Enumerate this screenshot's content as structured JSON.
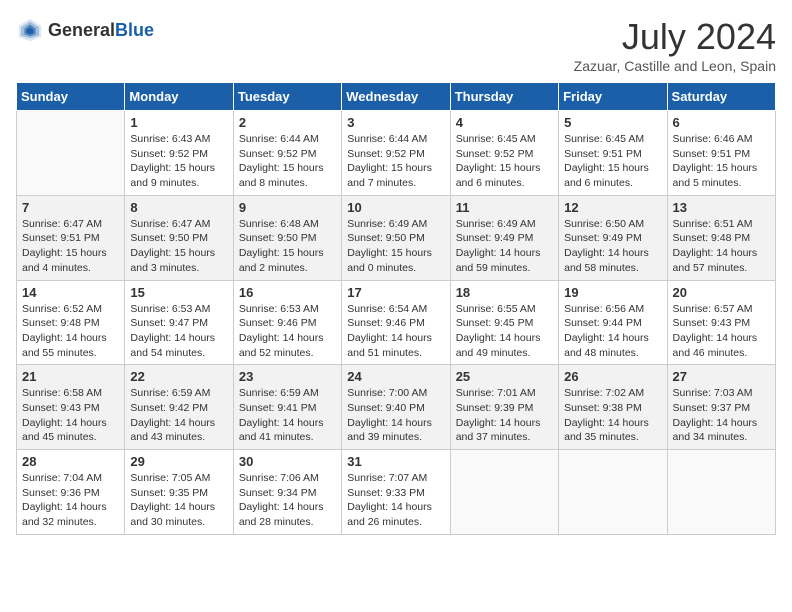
{
  "header": {
    "logo_general": "General",
    "logo_blue": "Blue",
    "month": "July 2024",
    "location": "Zazuar, Castille and Leon, Spain"
  },
  "days_of_week": [
    "Sunday",
    "Monday",
    "Tuesday",
    "Wednesday",
    "Thursday",
    "Friday",
    "Saturday"
  ],
  "weeks": [
    [
      {
        "day": "",
        "empty": true
      },
      {
        "day": "1",
        "sunrise": "Sunrise: 6:43 AM",
        "sunset": "Sunset: 9:52 PM",
        "daylight": "Daylight: 15 hours and 9 minutes."
      },
      {
        "day": "2",
        "sunrise": "Sunrise: 6:44 AM",
        "sunset": "Sunset: 9:52 PM",
        "daylight": "Daylight: 15 hours and 8 minutes."
      },
      {
        "day": "3",
        "sunrise": "Sunrise: 6:44 AM",
        "sunset": "Sunset: 9:52 PM",
        "daylight": "Daylight: 15 hours and 7 minutes."
      },
      {
        "day": "4",
        "sunrise": "Sunrise: 6:45 AM",
        "sunset": "Sunset: 9:52 PM",
        "daylight": "Daylight: 15 hours and 6 minutes."
      },
      {
        "day": "5",
        "sunrise": "Sunrise: 6:45 AM",
        "sunset": "Sunset: 9:51 PM",
        "daylight": "Daylight: 15 hours and 6 minutes."
      },
      {
        "day": "6",
        "sunrise": "Sunrise: 6:46 AM",
        "sunset": "Sunset: 9:51 PM",
        "daylight": "Daylight: 15 hours and 5 minutes."
      }
    ],
    [
      {
        "day": "7",
        "sunrise": "Sunrise: 6:47 AM",
        "sunset": "Sunset: 9:51 PM",
        "daylight": "Daylight: 15 hours and 4 minutes."
      },
      {
        "day": "8",
        "sunrise": "Sunrise: 6:47 AM",
        "sunset": "Sunset: 9:50 PM",
        "daylight": "Daylight: 15 hours and 3 minutes."
      },
      {
        "day": "9",
        "sunrise": "Sunrise: 6:48 AM",
        "sunset": "Sunset: 9:50 PM",
        "daylight": "Daylight: 15 hours and 2 minutes."
      },
      {
        "day": "10",
        "sunrise": "Sunrise: 6:49 AM",
        "sunset": "Sunset: 9:50 PM",
        "daylight": "Daylight: 15 hours and 0 minutes."
      },
      {
        "day": "11",
        "sunrise": "Sunrise: 6:49 AM",
        "sunset": "Sunset: 9:49 PM",
        "daylight": "Daylight: 14 hours and 59 minutes."
      },
      {
        "day": "12",
        "sunrise": "Sunrise: 6:50 AM",
        "sunset": "Sunset: 9:49 PM",
        "daylight": "Daylight: 14 hours and 58 minutes."
      },
      {
        "day": "13",
        "sunrise": "Sunrise: 6:51 AM",
        "sunset": "Sunset: 9:48 PM",
        "daylight": "Daylight: 14 hours and 57 minutes."
      }
    ],
    [
      {
        "day": "14",
        "sunrise": "Sunrise: 6:52 AM",
        "sunset": "Sunset: 9:48 PM",
        "daylight": "Daylight: 14 hours and 55 minutes."
      },
      {
        "day": "15",
        "sunrise": "Sunrise: 6:53 AM",
        "sunset": "Sunset: 9:47 PM",
        "daylight": "Daylight: 14 hours and 54 minutes."
      },
      {
        "day": "16",
        "sunrise": "Sunrise: 6:53 AM",
        "sunset": "Sunset: 9:46 PM",
        "daylight": "Daylight: 14 hours and 52 minutes."
      },
      {
        "day": "17",
        "sunrise": "Sunrise: 6:54 AM",
        "sunset": "Sunset: 9:46 PM",
        "daylight": "Daylight: 14 hours and 51 minutes."
      },
      {
        "day": "18",
        "sunrise": "Sunrise: 6:55 AM",
        "sunset": "Sunset: 9:45 PM",
        "daylight": "Daylight: 14 hours and 49 minutes."
      },
      {
        "day": "19",
        "sunrise": "Sunrise: 6:56 AM",
        "sunset": "Sunset: 9:44 PM",
        "daylight": "Daylight: 14 hours and 48 minutes."
      },
      {
        "day": "20",
        "sunrise": "Sunrise: 6:57 AM",
        "sunset": "Sunset: 9:43 PM",
        "daylight": "Daylight: 14 hours and 46 minutes."
      }
    ],
    [
      {
        "day": "21",
        "sunrise": "Sunrise: 6:58 AM",
        "sunset": "Sunset: 9:43 PM",
        "daylight": "Daylight: 14 hours and 45 minutes."
      },
      {
        "day": "22",
        "sunrise": "Sunrise: 6:59 AM",
        "sunset": "Sunset: 9:42 PM",
        "daylight": "Daylight: 14 hours and 43 minutes."
      },
      {
        "day": "23",
        "sunrise": "Sunrise: 6:59 AM",
        "sunset": "Sunset: 9:41 PM",
        "daylight": "Daylight: 14 hours and 41 minutes."
      },
      {
        "day": "24",
        "sunrise": "Sunrise: 7:00 AM",
        "sunset": "Sunset: 9:40 PM",
        "daylight": "Daylight: 14 hours and 39 minutes."
      },
      {
        "day": "25",
        "sunrise": "Sunrise: 7:01 AM",
        "sunset": "Sunset: 9:39 PM",
        "daylight": "Daylight: 14 hours and 37 minutes."
      },
      {
        "day": "26",
        "sunrise": "Sunrise: 7:02 AM",
        "sunset": "Sunset: 9:38 PM",
        "daylight": "Daylight: 14 hours and 35 minutes."
      },
      {
        "day": "27",
        "sunrise": "Sunrise: 7:03 AM",
        "sunset": "Sunset: 9:37 PM",
        "daylight": "Daylight: 14 hours and 34 minutes."
      }
    ],
    [
      {
        "day": "28",
        "sunrise": "Sunrise: 7:04 AM",
        "sunset": "Sunset: 9:36 PM",
        "daylight": "Daylight: 14 hours and 32 minutes."
      },
      {
        "day": "29",
        "sunrise": "Sunrise: 7:05 AM",
        "sunset": "Sunset: 9:35 PM",
        "daylight": "Daylight: 14 hours and 30 minutes."
      },
      {
        "day": "30",
        "sunrise": "Sunrise: 7:06 AM",
        "sunset": "Sunset: 9:34 PM",
        "daylight": "Daylight: 14 hours and 28 minutes."
      },
      {
        "day": "31",
        "sunrise": "Sunrise: 7:07 AM",
        "sunset": "Sunset: 9:33 PM",
        "daylight": "Daylight: 14 hours and 26 minutes."
      },
      {
        "day": "",
        "empty": true
      },
      {
        "day": "",
        "empty": true
      },
      {
        "day": "",
        "empty": true
      }
    ]
  ]
}
